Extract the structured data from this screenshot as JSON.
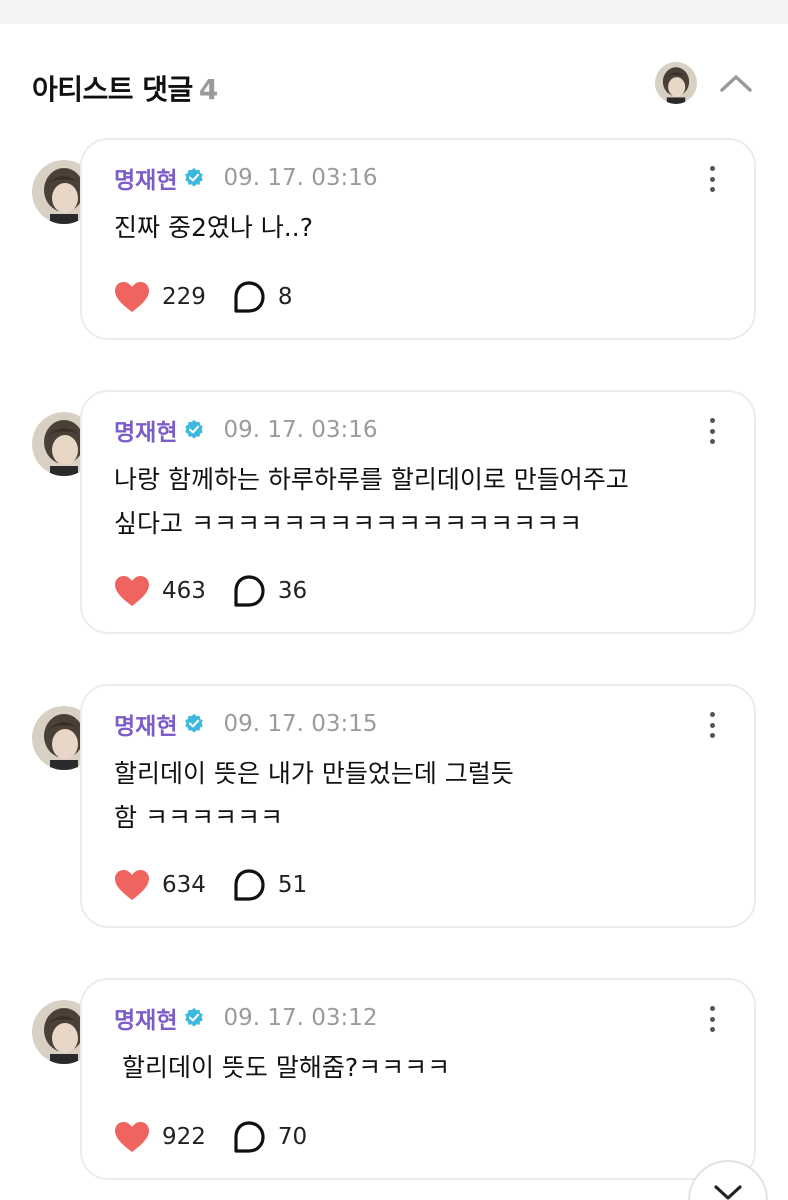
{
  "section": {
    "title": "아티스트 댓글",
    "count": "4"
  },
  "colors": {
    "author": "#7b5cc9",
    "verified": "#3fb8e0",
    "heart": "#f0645f",
    "time": "#9b9b9b"
  },
  "icons": {
    "collapse": "chevron-up-icon",
    "more": "more-vertical-icon",
    "like": "heart-icon",
    "reply": "speech-bubble-icon",
    "verified": "verified-badge-icon",
    "fab": "chevron-down-icon"
  },
  "comments": [
    {
      "author": "명재현",
      "time": "09. 17. 03:16",
      "text": "진짜 중2였나 나..?",
      "likes": "229",
      "replies": "8"
    },
    {
      "author": "명재현",
      "time": "09. 17. 03:16",
      "text": "나랑 함께하는 하루하루를 할리데이로 만들어주고\n싶다고 ㅋㅋㅋㅋㅋㅋㅋㅋㅋㅋㅋㅋㅋㅋㅋㅋㅋ",
      "likes": "463",
      "replies": "36"
    },
    {
      "author": "명재현",
      "time": "09. 17. 03:15",
      "text": "할리데이 뜻은 내가 만들었는데 그럴듯\n함 ㅋㅋㅋㅋㅋㅋ",
      "likes": "634",
      "replies": "51"
    },
    {
      "author": "명재현",
      "time": "09. 17. 03:12",
      "text": " 할리데이 뜻도 말해줌?ㅋㅋㅋㅋ",
      "likes": "922",
      "replies": "70"
    }
  ]
}
